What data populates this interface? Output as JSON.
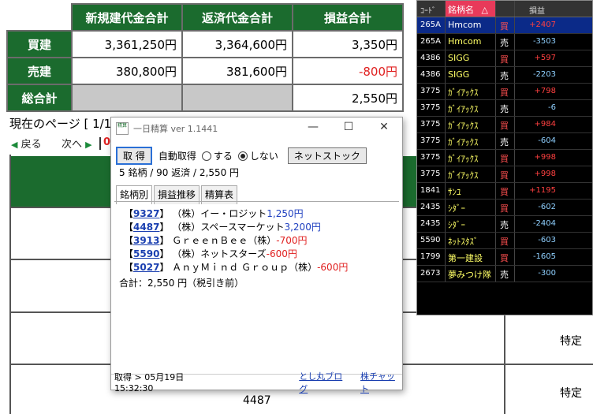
{
  "summary": {
    "headers": [
      "新規建代金合計",
      "返済代金合計",
      "損益合計"
    ],
    "rows": [
      {
        "label": "買建",
        "new": "3,361,250円",
        "close": "3,364,600円",
        "pnl": "3,350円",
        "pnl_negative": false
      },
      {
        "label": "売建",
        "new": "380,800円",
        "close": "381,600円",
        "pnl": "-800円",
        "pnl_negative": true
      },
      {
        "label": "総合計",
        "new": "",
        "close": "",
        "pnl": "2,550円",
        "pnl_negative": false
      }
    ]
  },
  "page": {
    "current": "現在のページ [ 1/1",
    "prev": "戻る",
    "next": "次へ",
    "trailing": "0"
  },
  "background_table": {
    "cell_tokutei_1": "特定",
    "cell_tokutei_2": "特定",
    "cell_code": "4487"
  },
  "board": {
    "headers": [
      "ｺｰﾄﾞ",
      "銘柄名",
      "",
      "損益"
    ],
    "sort_marker": "△",
    "rows": [
      {
        "code": "265A",
        "name": "Hmcom",
        "side": "買",
        "pnl": "+2407",
        "selected": true
      },
      {
        "code": "265A",
        "name": "Hmcom",
        "side": "売",
        "pnl": "-3503"
      },
      {
        "code": "4386",
        "name": "SIGG",
        "side": "買",
        "pnl": "+597"
      },
      {
        "code": "4386",
        "name": "SIGG",
        "side": "売",
        "pnl": "-2203"
      },
      {
        "code": "3775",
        "name": "ｶﾞｲｱｯｸｽ",
        "side": "買",
        "pnl": "+798"
      },
      {
        "code": "3775",
        "name": "ｶﾞｲｱｯｸｽ",
        "side": "売",
        "pnl": "-6"
      },
      {
        "code": "3775",
        "name": "ｶﾞｲｱｯｸｽ",
        "side": "買",
        "pnl": "+984"
      },
      {
        "code": "3775",
        "name": "ｶﾞｲｱｯｸｽ",
        "side": "売",
        "pnl": "-604"
      },
      {
        "code": "3775",
        "name": "ｶﾞｲｱｯｸｽ",
        "side": "買",
        "pnl": "+998"
      },
      {
        "code": "3775",
        "name": "ｶﾞｲｱｯｸｽ",
        "side": "買",
        "pnl": "+998"
      },
      {
        "code": "1841",
        "name": "ｻﾝﾕ",
        "side": "買",
        "pnl": "+1195"
      },
      {
        "code": "2435",
        "name": "ｼﾀﾞｰ",
        "side": "買",
        "pnl": "-602"
      },
      {
        "code": "2435",
        "name": "ｼﾀﾞｰ",
        "side": "売",
        "pnl": "-2404"
      },
      {
        "code": "5590",
        "name": "ﾈｯﾄｽﾀｽﾞ",
        "side": "買",
        "pnl": "-603"
      },
      {
        "code": "1799",
        "name": "第一建設",
        "side": "買",
        "pnl": "-1605"
      },
      {
        "code": "2673",
        "name": "夢みつけ隊",
        "side": "売",
        "pnl": "-300"
      }
    ]
  },
  "window": {
    "icon_text": "精算",
    "title": "一日精算 ver 1.1441",
    "minimize": "—",
    "maximize": "☐",
    "close": "✕",
    "fetch_btn": "取 得",
    "auto_label": "自動取得",
    "radio_yes": "する",
    "radio_no": "しない",
    "radio_selected": "no",
    "netstock_btn": "ネットストック",
    "summary_line": "5 銘柄 / 90 返済 / 2,550 円",
    "tabs": [
      "銘柄別",
      "損益推移",
      "精算表"
    ],
    "active_tab": 0,
    "items": [
      {
        "code": "9327",
        "name": "（株）イー・ロジット",
        "amount": "1,250円",
        "negative": false
      },
      {
        "code": "4487",
        "name": "（株）スペースマーケット",
        "amount": "3,200円",
        "negative": false
      },
      {
        "code": "3913",
        "name": "ＧｒｅｅｎＢｅｅ（株）",
        "amount": "-700円",
        "negative": true
      },
      {
        "code": "5590",
        "name": "（株）ネットスターズ",
        "amount": "-600円",
        "negative": true
      },
      {
        "code": "5027",
        "name": "ＡｎｙＭｉｎｄ Ｇｒｏｕｐ（株）",
        "amount": "-600円",
        "negative": true
      }
    ],
    "total": "合計：2,550 円（税引き前）",
    "status": "取得 > 05月19日 15:32:30",
    "link_blog": "とし丸ブログ",
    "link_chart": "株チャット"
  },
  "colors": {
    "header_green": "#1b6b2e",
    "negative": "#e02020",
    "board_bg": "#000000",
    "board_sel": "#0b2a88"
  }
}
